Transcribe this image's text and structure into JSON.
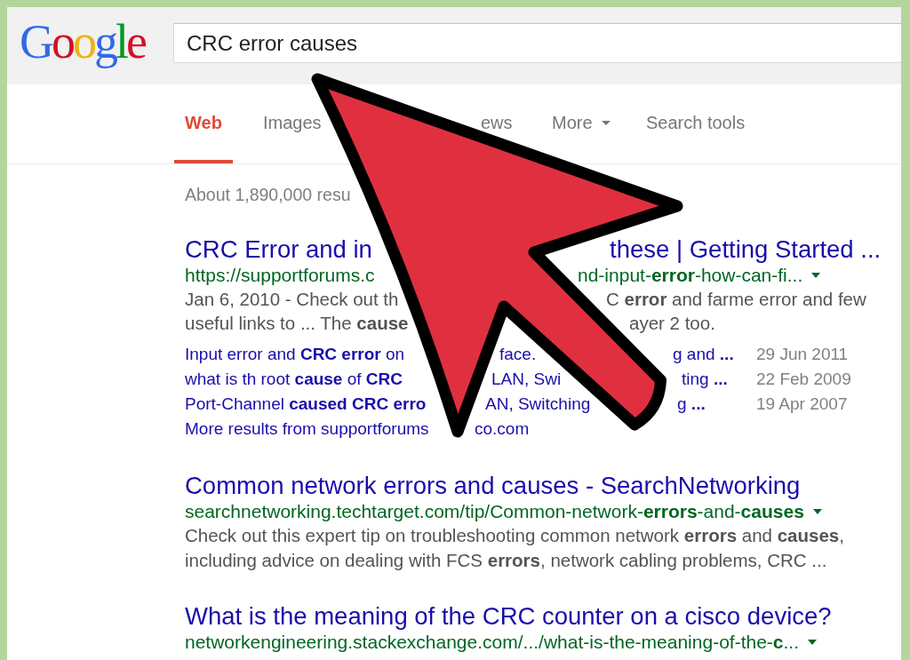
{
  "logo": "Google",
  "search": {
    "value": "CRC error causes"
  },
  "tabs": [
    {
      "label": "Web",
      "kind": "tab",
      "selected": true
    },
    {
      "label": "Images",
      "kind": "tab",
      "selected": false
    },
    {
      "label": "ews",
      "kind": "tab",
      "selected": false
    },
    {
      "label": "More",
      "kind": "menu",
      "selected": false
    },
    {
      "label": "Search tools",
      "kind": "tab",
      "selected": false
    }
  ],
  "result_stats": "About 1,890,000 resu",
  "results": [
    {
      "title": [
        "CRC Error and in",
        "these | Getting Started ..."
      ],
      "url": [
        "https://supportforums.c",
        "nd-input-**error**-how-can-fi..."
      ],
      "snippet": [
        [
          "Jan 6, 2010 - Check out th",
          "C **error** and farme error and few"
        ],
        [
          "useful links to ... The **cause**",
          "ayer 2 too."
        ]
      ],
      "sitelinks": [
        {
          "text": [
            "Input error and **CRC error** on",
            "face.",
            "g and **...**"
          ],
          "date": "29 Jun 2011"
        },
        {
          "text": [
            "what is th root **cause** of **CRC**",
            "LAN, Swi",
            "ting **...**"
          ],
          "date": "22 Feb 2009"
        },
        {
          "text": [
            "Port-Channel **caused CRC erro**",
            "AN, Switching",
            "g **...**"
          ],
          "date": "19 Apr 2007"
        }
      ],
      "more_results": [
        "More results from supportforums",
        "co.com"
      ]
    },
    {
      "title": [
        "Common network errors and causes - SearchNetworking"
      ],
      "url": [
        "searchnetworking.techtarget.com/tip/Common-network-**errors**-and-**causes**"
      ],
      "snippet": [
        [
          "Check out this expert tip on troubleshooting common network **errors** and **causes**,"
        ],
        [
          "including advice on dealing with FCS **errors**, network cabling problems, CRC ..."
        ]
      ]
    },
    {
      "title": [
        "What is the meaning of the CRC counter on a cisco device?"
      ],
      "url": [
        "networkengineering.stackexchange.com/.../what-is-the-meaning-of-the-**c**..."
      ]
    }
  ]
}
